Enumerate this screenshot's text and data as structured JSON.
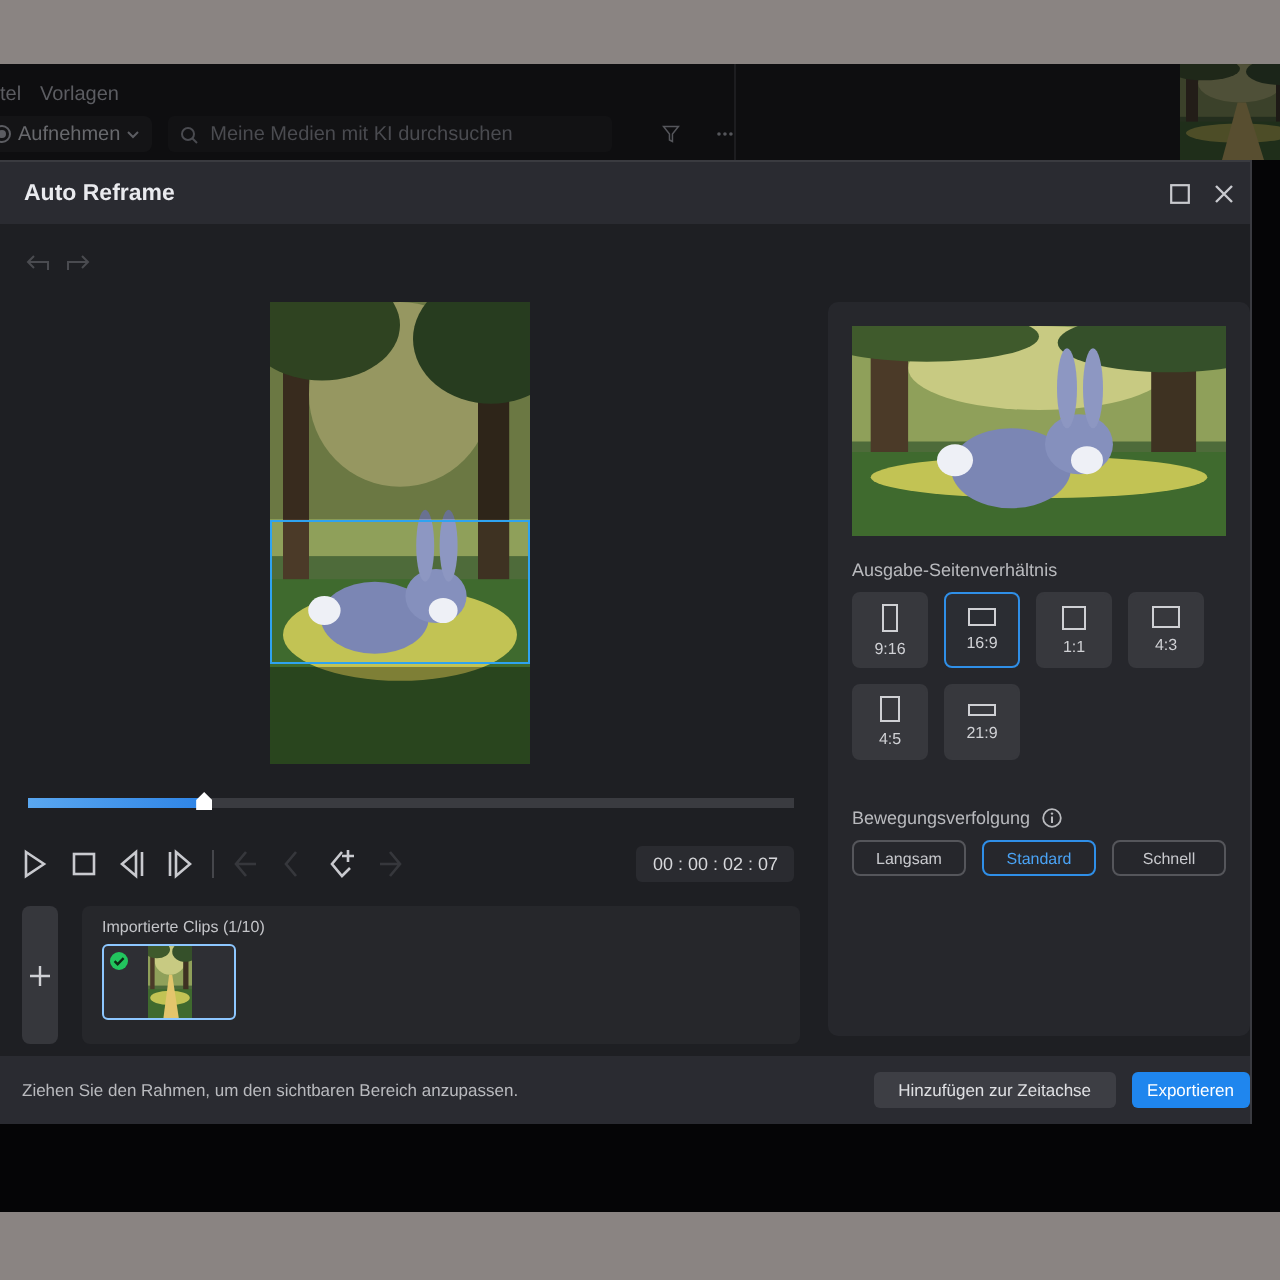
{
  "background_app": {
    "nav_items": [
      "tel",
      "Vorlagen"
    ],
    "record_button": "Aufnehmen",
    "search": {
      "placeholder": "Meine Medien mit KI durchsuchen"
    }
  },
  "window": {
    "title": "Auto Reframe"
  },
  "playback": {
    "level": 0.23,
    "timecode": "00 : 00 : 02 : 07",
    "controls": [
      {
        "kind": "play",
        "disabled": false
      },
      {
        "kind": "stop",
        "disabled": false
      },
      {
        "kind": "prev",
        "disabled": false
      },
      {
        "kind": "next",
        "disabled": false
      },
      {
        "kind": "divider"
      },
      {
        "kind": "key-left",
        "disabled": true
      },
      {
        "kind": "key-back",
        "disabled": true
      },
      {
        "kind": "key-add",
        "disabled": false
      },
      {
        "kind": "key-right",
        "disabled": true
      }
    ]
  },
  "clips": {
    "title": "Importierte Clips (1/10)",
    "items": [
      {
        "selected": true,
        "checked": true
      }
    ]
  },
  "aspect_ratio": {
    "label": "Ausgabe-Seitenverhältnis",
    "options": [
      {
        "label": "9:16",
        "kind": "portrait",
        "selected": false
      },
      {
        "label": "16:9",
        "kind": "landscape",
        "selected": true
      },
      {
        "label": "1:1",
        "kind": "square",
        "selected": false
      },
      {
        "label": "4:3",
        "kind": "classic",
        "selected": false
      },
      {
        "label": "4:5",
        "kind": "tall",
        "selected": false
      },
      {
        "label": "21:9",
        "kind": "ultrawide",
        "selected": false
      }
    ]
  },
  "motion_tracking": {
    "label": "Bewegungsverfolgung",
    "options": [
      {
        "label": "Langsam",
        "selected": false
      },
      {
        "label": "Standard",
        "selected": true
      },
      {
        "label": "Schnell",
        "selected": false
      }
    ]
  },
  "footer": {
    "hint": "Ziehen Sie den Rahmen, um den sichtbaren Bereich anzupassen.",
    "buttons": [
      {
        "label": "Hinzufügen zur Zeitachse",
        "kind": "secondary"
      },
      {
        "label": "Exportieren",
        "kind": "primary"
      }
    ]
  }
}
